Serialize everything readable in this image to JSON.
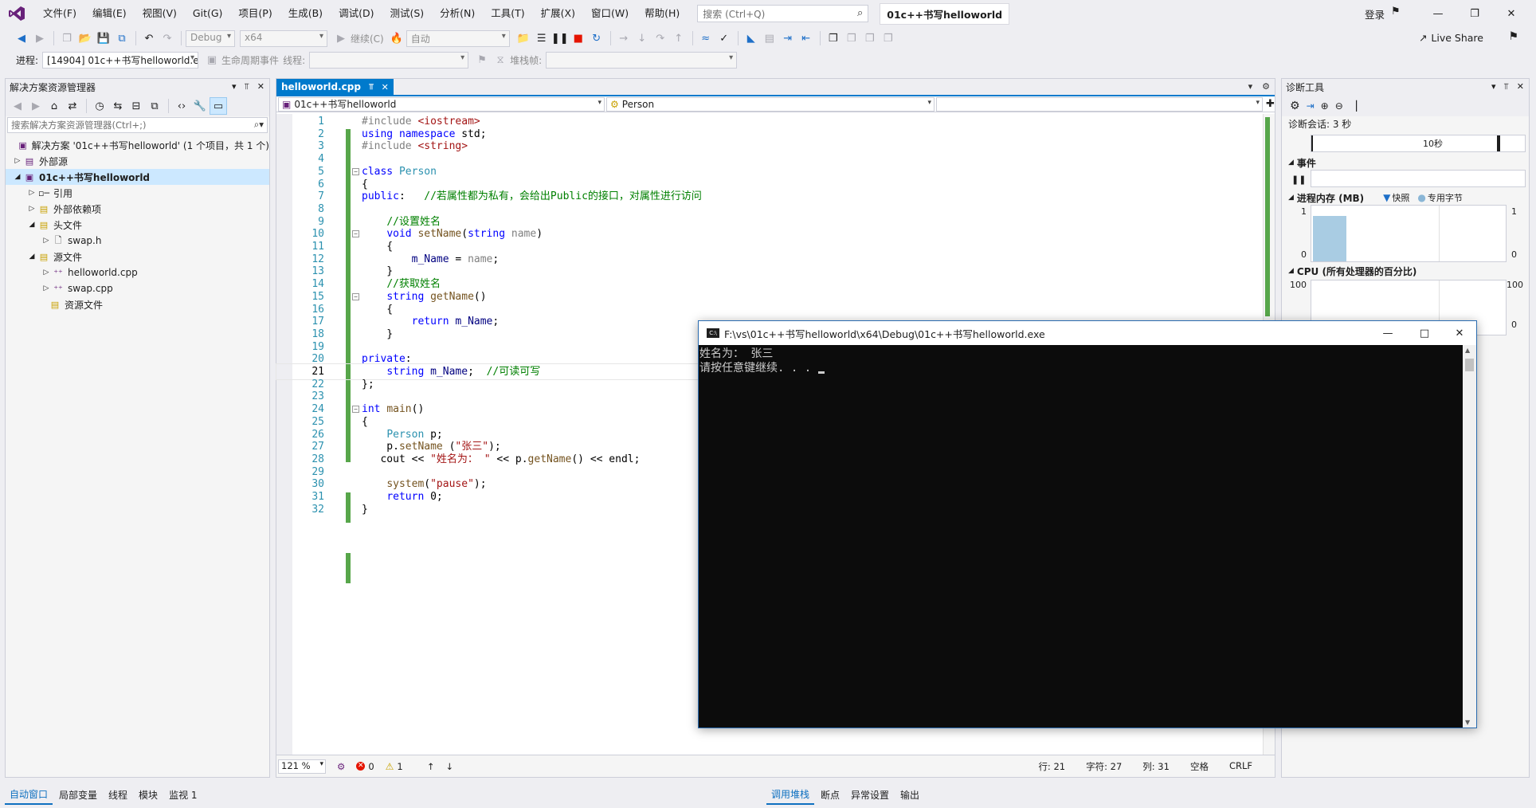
{
  "menu": {
    "items": [
      "文件(F)",
      "编辑(E)",
      "视图(V)",
      "Git(G)",
      "项目(P)",
      "生成(B)",
      "调试(D)",
      "测试(S)",
      "分析(N)",
      "工具(T)",
      "扩展(X)",
      "窗口(W)",
      "帮助(H)"
    ],
    "search_placeholder": "搜索 (Ctrl+Q)",
    "solution_name": "01c++书写helloworld",
    "login": "登录"
  },
  "toolbar": {
    "config": "Debug",
    "platform": "x64",
    "continue": "继续(C)",
    "auto": "自动",
    "live_share": "Live Share",
    "process_label": "进程:",
    "process_value": "[14904] 01c++书写helloworld.e",
    "lifecycle": "生命周期事件",
    "thread_label": "线程:",
    "stackframe_label": "堆栈帧:"
  },
  "solution_explorer": {
    "title": "解决方案资源管理器",
    "search_placeholder": "搜索解决方案资源管理器(Ctrl+;)",
    "items": [
      {
        "label": "解决方案 '01c++书写helloworld' (1 个项目，共 1 个)"
      },
      {
        "label": "外部源"
      },
      {
        "label": "01c++书写helloworld"
      },
      {
        "label": "引用"
      },
      {
        "label": "外部依赖项"
      },
      {
        "label": "头文件"
      },
      {
        "label": "swap.h"
      },
      {
        "label": "源文件"
      },
      {
        "label": "helloworld.cpp"
      },
      {
        "label": "swap.cpp"
      },
      {
        "label": "资源文件"
      }
    ]
  },
  "editor": {
    "tab": "helloworld.cpp",
    "nav_project": "01c++书写helloworld",
    "nav_class": "Person",
    "zoom": "121 %",
    "errors": "0",
    "warnings": "1",
    "row": "行: 21",
    "char": "字符: 27",
    "col": "列: 31",
    "spaces": "空格",
    "eol": "CRLF",
    "line_numbers": [
      "1",
      "2",
      "3",
      "4",
      "5",
      "6",
      "7",
      "8",
      "9",
      "10",
      "11",
      "12",
      "13",
      "14",
      "15",
      "16",
      "17",
      "18",
      "19",
      "20",
      "21",
      "22",
      "23",
      "24",
      "25",
      "26",
      "27",
      "28",
      "29",
      "30",
      "31",
      "32"
    ]
  },
  "diagnostics": {
    "title": "诊断工具",
    "session": "诊断会话: 3 秒",
    "timeline_label": "10秒",
    "events": "事件",
    "memory": "进程内存 (MB)",
    "snapshot": "快照",
    "private_bytes": "专用字节",
    "mem_top": "1",
    "mem_bottom": "0",
    "cpu": "CPU (所有处理器的百分比)",
    "cpu_top": "100",
    "cpu_bottom": "0",
    "mem_fill": 0.95
  },
  "console": {
    "title": "F:\\vs\\01c++书写helloworld\\x64\\Debug\\01c++书写helloworld.exe",
    "line1": "姓名为： 张三",
    "line2": "请按任意键继续. . . "
  },
  "bottom_left_tabs": [
    "自动窗口",
    "局部变量",
    "线程",
    "模块",
    "监视 1"
  ],
  "bottom_right_tabs": [
    "调用堆栈",
    "断点",
    "异常设置",
    "输出"
  ],
  "colors": {
    "accent": "#007acc",
    "change_bar": "#57a64a",
    "console_bg": "#0c0c0c"
  }
}
